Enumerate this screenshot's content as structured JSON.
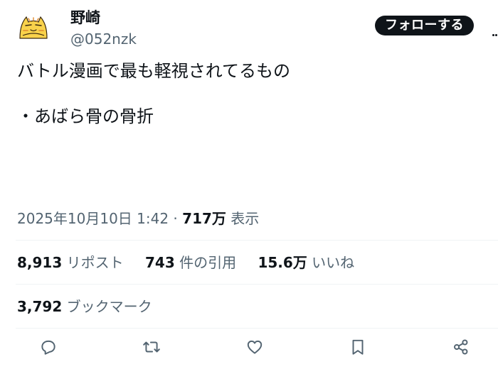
{
  "user": {
    "display_name": "野崎",
    "handle": "@052nzk"
  },
  "follow_label": "フォローする",
  "tweet": {
    "text": "バトル漫画で最も軽視されてるもの\n\n・あばら骨の骨折"
  },
  "meta": {
    "timestamp": "2025年10月10日 1:42",
    "separator": " · ",
    "views_count": "717万",
    "views_label": " 表示"
  },
  "stats": {
    "reposts_count": "8,913",
    "reposts_label": "リポスト",
    "quotes_count": "743",
    "quotes_label": "件の引用",
    "likes_count": "15.6万",
    "likes_label": "いいね",
    "bookmarks_count": "3,792",
    "bookmarks_label": "ブックマーク"
  },
  "icons": [
    "more-icon",
    "reply-icon",
    "retweet-icon",
    "like-icon",
    "bookmark-icon",
    "share-icon"
  ],
  "colors": {
    "text": "#0f1419",
    "secondary": "#536471",
    "divider": "#eff3f4",
    "avatar_yellow": "#f9d24b"
  }
}
